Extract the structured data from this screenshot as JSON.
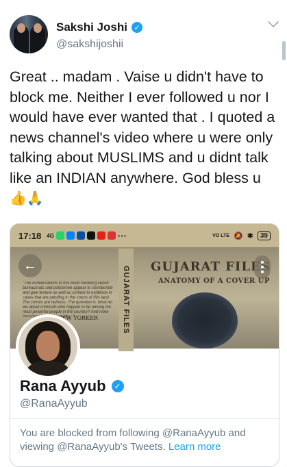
{
  "tweet": {
    "author_name": "Sakshi Joshi",
    "author_handle": "@sakshijoshii",
    "text": "Great .. madam . Vaise u didn't have to block me. Neither I ever followed u nor I would have ever wanted that . I quoted a news channel's video where u were only talking about MUSLIMS and u didnt talk like an INDIAN anywhere. God bless u ",
    "emojis": "👍🙏"
  },
  "card": {
    "status_bar": {
      "time": "17:18",
      "signal": "4G",
      "network": "VO LTE",
      "battery": "39"
    },
    "banner": {
      "book_title": "GUJARAT FILES",
      "book_subtitle": "ANATOMY OF A COVER UP",
      "spine_text": "GUJARAT FILES",
      "blurb": "\"The conversations in this book involving senior bureaucrats and policemen appear to corroborate and give texture as well as context to evidence in cases that are pending in the courts of this land. The crimes are heinous. The question is: what do we about criminals who happen to be among the most powerful people in the country? And more important, what do we do ...\"",
      "publication": "THE NEW YORKER"
    },
    "profile": {
      "name": "Rana Ayyub",
      "handle": "@RanaAyyub"
    },
    "blocked_message": "You are blocked from following @RanaAyyub and viewing @RanaAyyub's Tweets. ",
    "learn_more": "Learn more"
  },
  "colors": {
    "accent": "#1da1f2",
    "text_primary": "#14171a",
    "text_secondary": "#657786",
    "border": "#ccd6dd"
  },
  "icons": {
    "verified": "verified-badge-icon",
    "chevron": "chevron-down-icon",
    "back": "back-arrow-icon",
    "more": "more-vertical-icon"
  }
}
